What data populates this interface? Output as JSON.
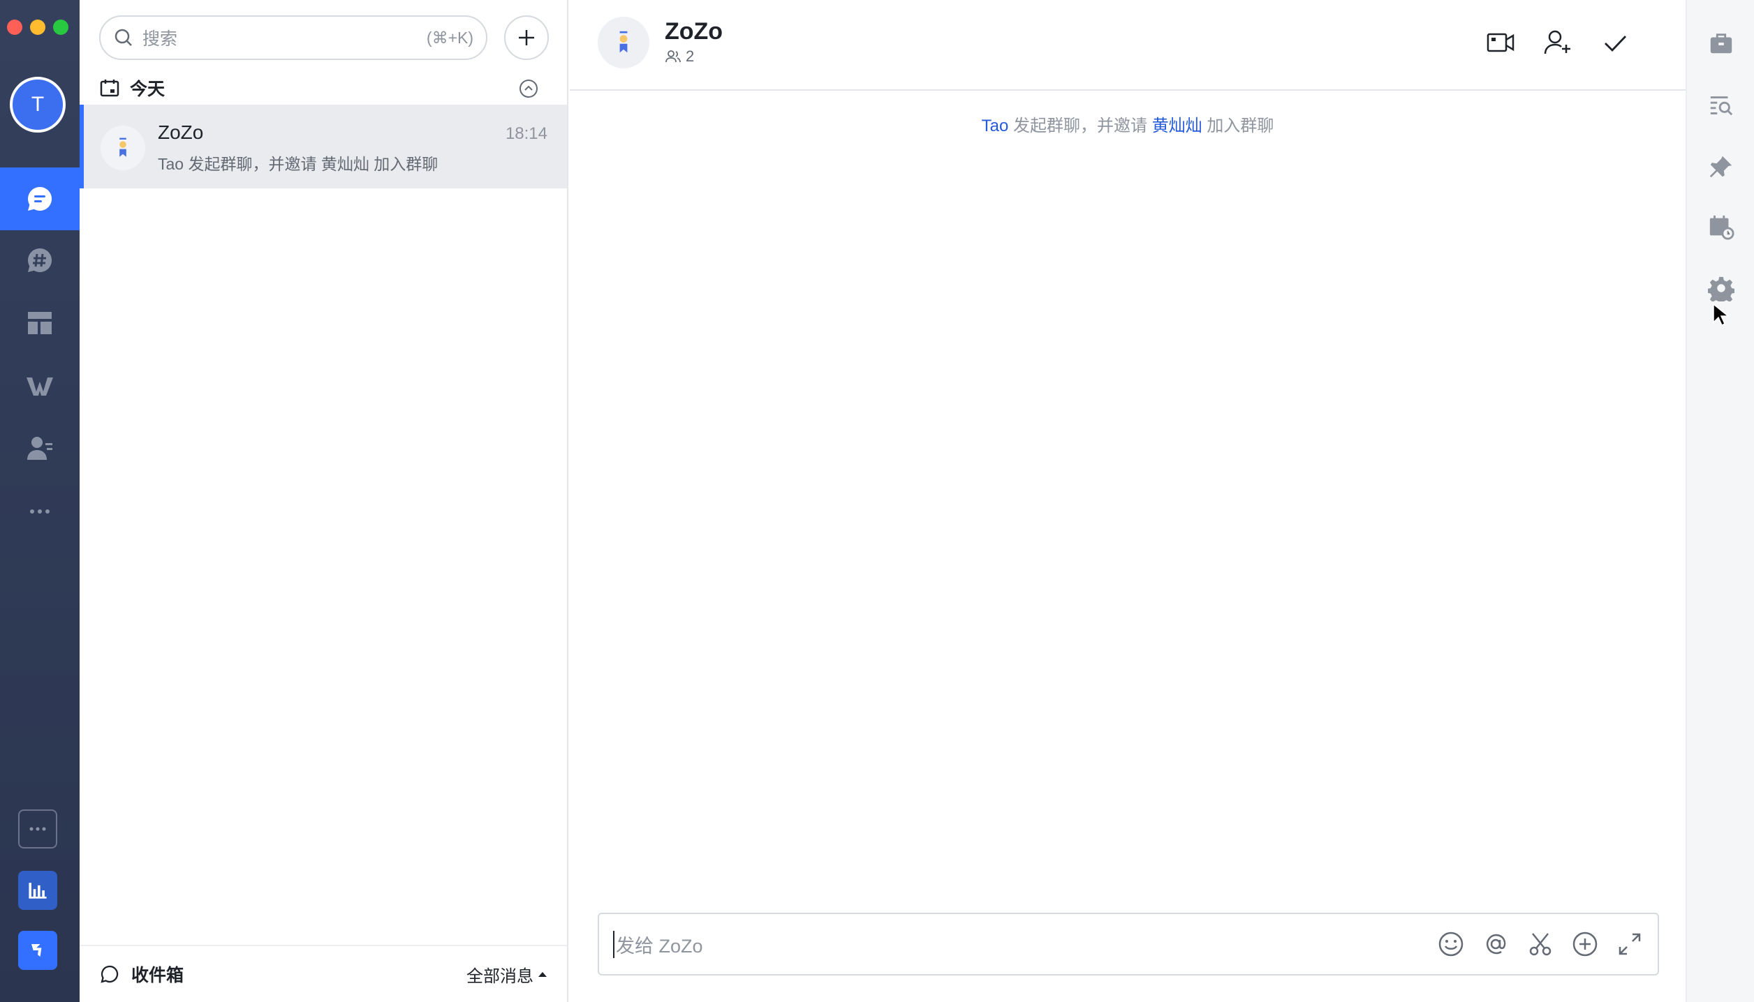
{
  "rail": {
    "avatar_letter": "T",
    "items": [
      {
        "name": "messages",
        "icon": "chat-bubble-icon",
        "active": true
      },
      {
        "name": "topics",
        "icon": "hashtag-bubble-icon",
        "active": false
      },
      {
        "name": "workspace",
        "icon": "layout-icon",
        "active": false
      },
      {
        "name": "docs",
        "icon": "w-logo-icon",
        "active": false
      },
      {
        "name": "contacts",
        "icon": "contacts-icon",
        "active": false
      },
      {
        "name": "more",
        "icon": "ellipsis-icon",
        "active": false
      }
    ],
    "bottom": [
      {
        "name": "more-apps",
        "icon": "ellipsis-box-icon"
      },
      {
        "name": "analytics-app",
        "icon": "bar-chart-icon"
      },
      {
        "name": "lark-app",
        "icon": "lark-logo-icon"
      }
    ],
    "accent": "#3370ff"
  },
  "list": {
    "search_placeholder": "搜索",
    "search_shortcut": "(⌘+K)",
    "group_label": "今天",
    "conversations": [
      {
        "name": "ZoZo",
        "time": "18:14",
        "preview": "Tao 发起群聊，并邀请 黄灿灿 加入群聊"
      }
    ],
    "footer": {
      "inbox_label": "收件箱",
      "filter_label": "全部消息"
    }
  },
  "chat": {
    "title": "ZoZo",
    "member_count": "2",
    "system_message": {
      "actor": "Tao",
      "text1": "发起群聊，并邀请",
      "invitee": "黄灿灿",
      "text2": "加入群聊"
    },
    "composer_placeholder": "发给 ZoZo",
    "header_actions": [
      "video-call-icon",
      "add-member-icon",
      "check-icon"
    ],
    "composer_tools": [
      "emoji-icon",
      "mention-icon",
      "scissors-icon",
      "plus-circle-icon",
      "expand-icon"
    ]
  },
  "right_toolbar": [
    "briefcase-icon",
    "search-list-icon",
    "pin-icon",
    "calendar-icon",
    "gear-icon"
  ]
}
